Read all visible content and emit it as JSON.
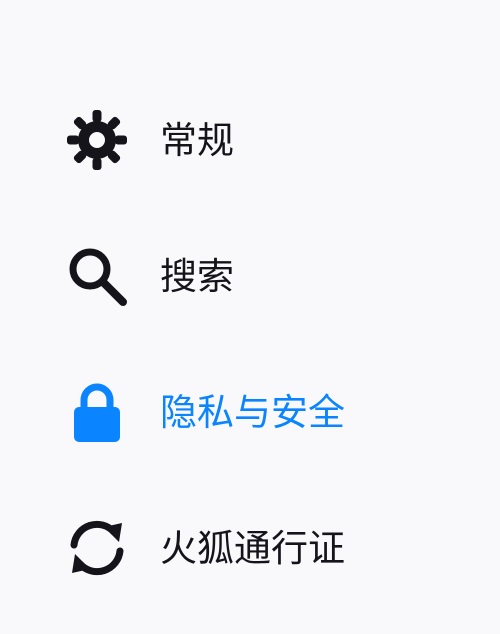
{
  "sidebar": {
    "items": [
      {
        "label": "常规",
        "icon": "gear-icon",
        "selected": false
      },
      {
        "label": "搜索",
        "icon": "search-icon",
        "selected": false
      },
      {
        "label": "隐私与安全",
        "icon": "lock-icon",
        "selected": true
      },
      {
        "label": "火狐通行证",
        "icon": "sync-icon",
        "selected": false
      }
    ]
  },
  "colors": {
    "text": "#15141a",
    "accent": "#0a84ff",
    "background": "#f9f9fb"
  }
}
